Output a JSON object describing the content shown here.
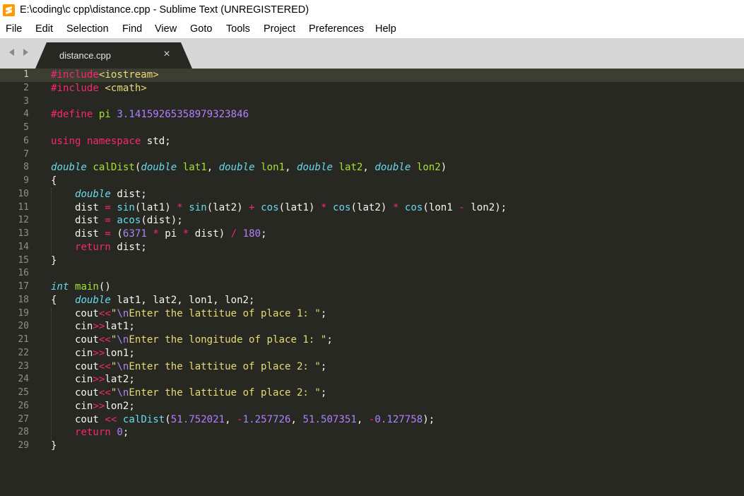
{
  "window": {
    "title": "E:\\coding\\c cpp\\distance.cpp - Sublime Text (UNREGISTERED)"
  },
  "menu": [
    "File",
    "Edit",
    "Selection",
    "Find",
    "View",
    "Goto",
    "Tools",
    "Project",
    "Preferences",
    "Help"
  ],
  "tab": {
    "label": "distance.cpp"
  },
  "editor": {
    "current_line": 1,
    "lines": [
      "#include<iostream>",
      "#include <cmath>",
      "",
      "#define pi 3.14159265358979323846",
      "",
      "using namespace std;",
      "",
      "double calDist(double lat1, double lon1, double lat2, double lon2)",
      "{",
      "    double dist;",
      "    dist = sin(lat1) * sin(lat2) + cos(lat1) * cos(lat2) * cos(lon1 - lon2);",
      "    dist = acos(dist);",
      "    dist = (6371 * pi * dist) / 180;",
      "    return dist;",
      "}",
      "",
      "int main()",
      "{   double lat1, lat2, lon1, lon2;",
      "    cout<<\"\\nEnter the lattitue of place 1: \";",
      "    cin>>lat1;",
      "    cout<<\"\\nEnter the longitude of place 1: \";",
      "    cin>>lon1;",
      "    cout<<\"\\nEnter the lattitue of place 2: \";",
      "    cin>>lat2;",
      "    cout<<\"\\nEnter the lattitue of place 2: \";",
      "    cin>>lon2;",
      "    cout << calDist(51.752021, -1.257726, 51.507351, -0.127758);",
      "    return 0;",
      "}"
    ]
  },
  "colors": {
    "editor_background": "#272822",
    "tabbar_background": "#d7d7d7",
    "active_tab": "#272822",
    "app_icon": "#ff9800"
  }
}
